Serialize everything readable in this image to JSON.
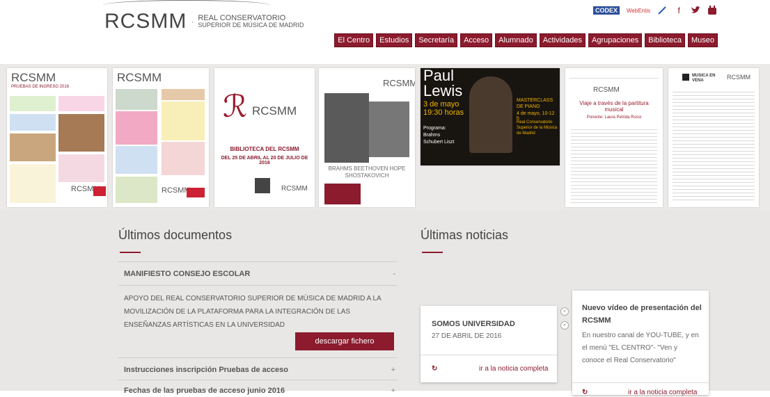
{
  "header": {
    "logo": {
      "main": "RCSMM",
      "line1": "REAL CONSERVATORIO",
      "line2": "SUPERIOR DE MÚSICA DE MADRID"
    },
    "top_icons": {
      "codex": "CODEX",
      "web": "WebEntis"
    }
  },
  "nav": [
    "El Centro",
    "Estudios",
    "Secretaría",
    "Acceso",
    "Alumnado",
    "Actividades",
    "Agrupaciones",
    "Biblioteca",
    "Museo"
  ],
  "banner": {
    "poster1": {
      "logo": "RCSMM",
      "subtitle": "PRUEBAS DE INGRESO 2016"
    },
    "poster2": {
      "logo": "RCSMM"
    },
    "poster3": {
      "title": "BIBLIOTECA DEL RCSMM",
      "dates": "DEL 25 DE ABRIL AL 20 DE JULIO DE 2016"
    },
    "poster4": {
      "composers": "BRAHMS BEETHOVEN HOPE SHOSTAKOVICH"
    },
    "poster5": {
      "name1": "Paul",
      "name2": "Lewis",
      "date": "3 de mayo",
      "time": "19:30 horas",
      "program": "Programa: Brahms Schubert Liszt",
      "masterclass": "MASTERCLASS DE PIANO",
      "mc_date": "4 de mayo, 10-12 h",
      "place": "Real Conservatorio Superior de la Música de Madrid"
    },
    "poster6": {
      "title": "Viaje a través de la partitura musical",
      "speaker": "Ponente: Laura Petrida Rossi"
    },
    "poster7": {
      "title": "MUSICA EN VENA"
    }
  },
  "documents": {
    "title": "Últimos documentos",
    "items": [
      {
        "title": "MANIFIESTO CONSEJO ESCOLAR",
        "sign": "-",
        "body": "APOYO DEL REAL CONSERVATORIO SUPERIOR DE MÚSICA DE MADRID A LA MOVILIZACIÓN DE LA PLATAFORMA PARA LA INTEGRACIÓN DE LAS ENSEÑANZAS ARTÍSTICAS EN LA UNIVERSIDAD",
        "button": "descargar fichero"
      },
      {
        "title": "Instrucciones inscripción Pruebas de acceso",
        "sign": "+"
      },
      {
        "title": "Fechas de las pruebas de acceso junio 2016",
        "sign": "+"
      }
    ]
  },
  "news": {
    "title": "Últimas noticias",
    "card1": {
      "title": "SOMOS UNIVERSIDAD",
      "date": "27 DE ABRIL DE 2016",
      "link": "ir a la noticia completa"
    },
    "card2": {
      "title": "Nuevo vídeo de presentación del RCSMM",
      "body": "En nuestro canal de YOU-TUBE, y en el menú \"EL CENTRO\"- \"Ven y conoce el Real Conservatorio\"",
      "link": "ir a la noticia completa"
    }
  },
  "colors": {
    "accent": "#8b1b2d",
    "background": "#e9e7e5"
  }
}
